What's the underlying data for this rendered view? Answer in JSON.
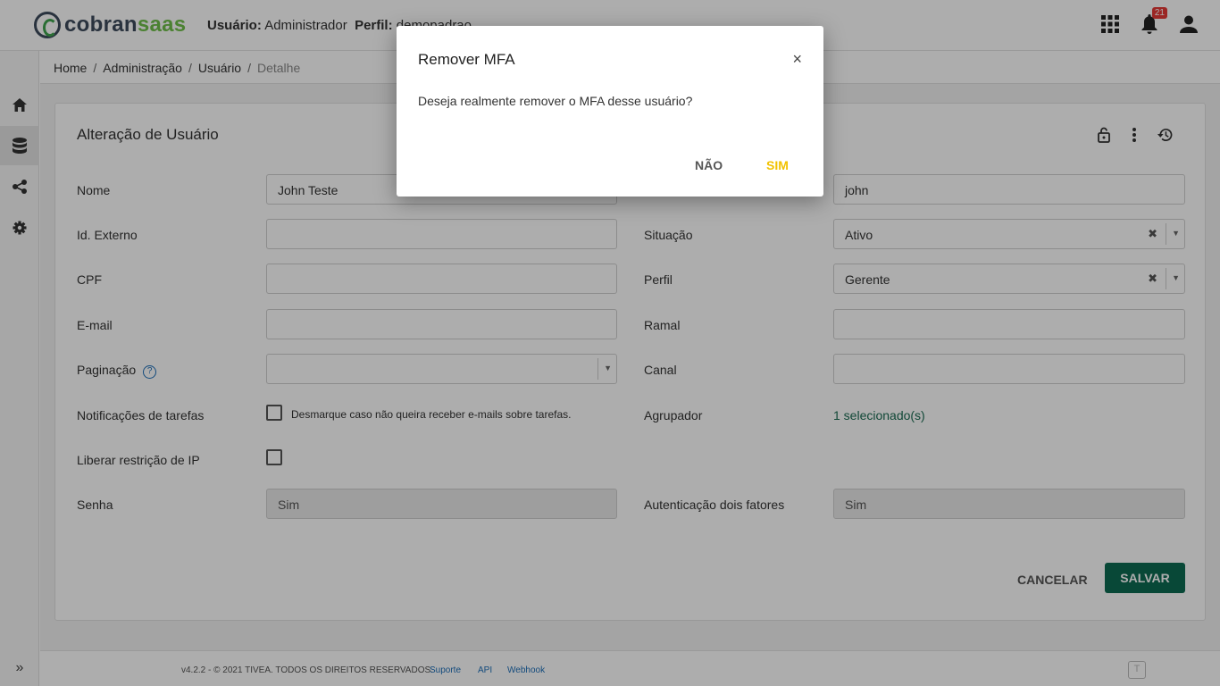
{
  "header": {
    "logo_part1": "cobran",
    "logo_part2": "saas",
    "user_label": "Usuário:",
    "user_value": "Administrador",
    "profile_label": "Perfil:",
    "profile_value": "demopadrao",
    "notifications_count": "21",
    "icons": [
      "apps-grid-icon",
      "bell-icon",
      "user-icon"
    ]
  },
  "sidebar": {
    "items": [
      "home-icon",
      "database-icon",
      "share-icon",
      "gear-icon"
    ],
    "active_index": 1,
    "expand_label": "»"
  },
  "breadcrumb": [
    "Home",
    "Administração",
    "Usuário",
    "Detalhe"
  ],
  "form": {
    "title": "Alteração de Usuário",
    "actions": [
      "lock-icon",
      "more-vert-icon",
      "history-icon"
    ],
    "nome_label": "Nome",
    "nome_value": "John Teste",
    "login_value": "john",
    "id_externo_label": "Id. Externo",
    "id_externo_value": "",
    "situacao_label": "Situação",
    "situacao_value": "Ativo",
    "cpf_label": "CPF",
    "cpf_value": "",
    "perfil_label": "Perfil",
    "perfil_value": "Gerente",
    "email_label": "E-mail",
    "email_value": "",
    "ramal_label": "Ramal",
    "ramal_value": "",
    "paginacao_label": "Paginação",
    "paginacao_value": "",
    "canal_label": "Canal",
    "canal_value": "",
    "notificacoes_label": "Notificações de tarefas",
    "notificacoes_hint": "Desmarque caso não queira receber e-mails sobre tarefas.",
    "notificacoes_checked": false,
    "agrupador_label": "Agrupador",
    "agrupador_value": "1 selecionado(s)",
    "liberar_ip_label": "Liberar restrição de IP",
    "liberar_ip_checked": false,
    "senha_label": "Senha",
    "senha_value": "Sim",
    "mfa_label": "Autenticação dois fatores",
    "mfa_value": "Sim",
    "cancel_label": "CANCELAR",
    "save_label": "SALVAR",
    "accent_color": "#0d6b52"
  },
  "footer": {
    "copyright": "v4.2.2 - © 2021 TIVEA. TODOS OS DIREITOS RESERVADOS.",
    "links": [
      "Suporte",
      "API",
      "Webhook"
    ]
  },
  "modal": {
    "title": "Remover MFA",
    "close_symbol": "×",
    "message": "Deseja realmente remover o MFA desse usuário?",
    "no_label": "NÃO",
    "yes_label": "SIM",
    "yes_color": "#f2c200"
  }
}
